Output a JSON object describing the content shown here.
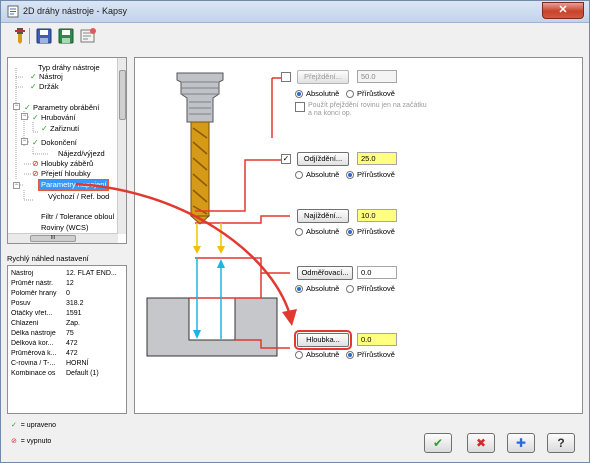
{
  "window": {
    "title": "2D dráhy nástroje - Kapsy",
    "close_label": "✕"
  },
  "toolbar": {
    "icons": [
      "tool-icon",
      "save-icon",
      "save-all-icon",
      "settings-icon"
    ]
  },
  "tree": {
    "items": [
      {
        "label": "Typ dráhy nástroje",
        "icon": "none"
      },
      {
        "label": "Nástroj",
        "icon": "check"
      },
      {
        "label": "Držák",
        "icon": "check"
      },
      {
        "label": "Parametry obrábění",
        "icon": "check"
      },
      {
        "label": "Hrubování",
        "icon": "check"
      },
      {
        "label": "Zařiznutí",
        "icon": "check"
      },
      {
        "label": "Dokončení",
        "icon": "check"
      },
      {
        "label": "Nájezd/výjezd",
        "icon": "none"
      },
      {
        "label": "Hloubky záběrů",
        "icon": "disabled"
      },
      {
        "label": "Přejetí hloubky",
        "icon": "disabled"
      },
      {
        "label": "Parametry napojení",
        "icon": "none"
      },
      {
        "label": "Výchozí / Ref. bod",
        "icon": "none"
      },
      {
        "label": "Filtr / Tolerance obloul",
        "icon": "none"
      },
      {
        "label": "Roviny (WCS)",
        "icon": "none"
      }
    ],
    "scroll_label": "III"
  },
  "preview": {
    "title": "Rychlý náhled nastavení",
    "rows": [
      {
        "key": "Nástroj",
        "value": "12. FLAT END..."
      },
      {
        "key": "Průměr nástr.",
        "value": "12"
      },
      {
        "key": "Poloměr hrany",
        "value": "0"
      },
      {
        "key": "Posuv",
        "value": "318.2"
      },
      {
        "key": "Otáčky vřet...",
        "value": "1591"
      },
      {
        "key": "Chlazení",
        "value": "Zap."
      },
      {
        "key": "Délka nástroje",
        "value": "75"
      },
      {
        "key": "Délková kor...",
        "value": "472"
      },
      {
        "key": "Průměrová k...",
        "value": "472"
      },
      {
        "key": "C-rovina / T-...",
        "value": "HORNÍ"
      },
      {
        "key": "Kombinace os",
        "value": "Default (1)"
      }
    ]
  },
  "legend": {
    "modified": "= upraveno",
    "disabled": "= vypnuto"
  },
  "params": {
    "clearance": {
      "label": "Přejždění...",
      "value": "50.0",
      "checked": false,
      "absolute": "Absolutně",
      "incremental": "Přírůstkově",
      "mode": "absolute",
      "note": "Použít přejždění rovinu jen na začátku a na konci op."
    },
    "retract": {
      "label": "Odjíždění...",
      "value": "25.0",
      "checked": true,
      "absolute": "Absolutně",
      "incremental": "Přírůstkově",
      "mode": "incremental"
    },
    "feed": {
      "label": "Najíždění...",
      "value": "10.0",
      "absolute": "Absolutně",
      "incremental": "Přírůstkově",
      "mode": "incremental"
    },
    "stock": {
      "label": "Odměřovací...",
      "value": "0.0",
      "absolute": "Absolutně",
      "incremental": "Přírůstkově",
      "mode": "absolute"
    },
    "depth": {
      "label": "Hloubka...",
      "value": "0.0",
      "absolute": "Absolutně",
      "incremental": "Přírůstkově",
      "mode": "incremental"
    }
  },
  "footer": {
    "ok": "✔",
    "cancel": "✖",
    "add": "✚",
    "help": "?"
  },
  "colors": {
    "accent_red": "#e2382f",
    "input_yellow": "#ffff80",
    "check_green": "#2e9e2e",
    "ok_green": "#2e9e2e",
    "cancel_red": "#d22a2a",
    "help_blue": "#2a6ad9"
  }
}
